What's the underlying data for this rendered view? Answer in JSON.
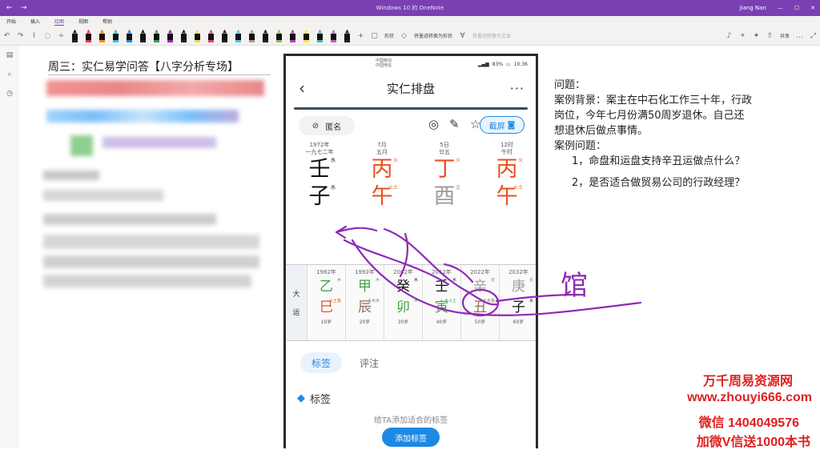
{
  "window": {
    "title": "Windows 10 的 OneNote",
    "user": "Jiang Nan"
  },
  "menu": [
    "开始",
    "插入",
    "绘图",
    "视图",
    "帮助"
  ],
  "menu_active": 2,
  "toolbar": {
    "shape_label": "形状",
    "ink_to_shape": "将墨迹转换为形状",
    "ink_to_text": "将墨迹转换为文本",
    "share": "共享"
  },
  "pens": [
    "#222222",
    "#e53935",
    "#fb8c00",
    "#26c6da",
    "#1e88e5",
    "#212121",
    "#43a047",
    "#9c27b0",
    "#212121",
    "#fdd835",
    "#ec407a",
    "#212121",
    "#4fc3f7",
    "#9e9e9e",
    "#212121",
    "#8bc34a",
    "#ab47bc",
    "#ffeb3b",
    "#4db6ac",
    "#ba68c8",
    "#212121"
  ],
  "doc": {
    "title": "周三：实仁易学问答【八字分析专场】"
  },
  "phone": {
    "status": {
      "carrier1": "中国移动",
      "carrier2": "中国电信",
      "battery": "83%",
      "time": "10:36"
    },
    "nav_title": "实仁排盘",
    "anon_label": "匿名",
    "screenshot_label": "截屏",
    "pillars": [
      {
        "l1": "1972年",
        "l2": "一九七二年",
        "gan": "壬",
        "zhi": "子",
        "gan_color": "#111111",
        "zhi_color": "#111111",
        "gsup": "水",
        "zsup": "水"
      },
      {
        "l1": "7月",
        "l2": "五月",
        "gan": "丙",
        "zhi": "午",
        "gan_color": "#e8501f",
        "zhi_color": "#e8501f",
        "gsup": "火",
        "zsup": "火土"
      },
      {
        "l1": "5日",
        "l2": "廿五",
        "gan": "丁",
        "zhi": "酉",
        "gan_color": "#e8501f",
        "zhi_color": "#9e9e9e",
        "gsup": "火",
        "zsup": "金"
      },
      {
        "l1": "12时",
        "l2": "午时",
        "gan": "丙",
        "zhi": "午",
        "gan_color": "#e8501f",
        "zhi_color": "#e8501f",
        "gsup": "火",
        "zsup": "火土"
      }
    ],
    "dayun_side": [
      "大",
      "运"
    ],
    "dayun": [
      {
        "yr": "1982年",
        "g": "乙",
        "z": "巳",
        "gc": "#43a047",
        "zc": "#e8501f",
        "age": "10岁",
        "gs": "木",
        "zs": "火土金"
      },
      {
        "yr": "1992年",
        "g": "甲",
        "z": "辰",
        "gc": "#43a047",
        "zc": "#8d6e63",
        "age": "20岁",
        "gs": "木",
        "zs": "土木水"
      },
      {
        "yr": "2002年",
        "g": "癸",
        "z": "卯",
        "gc": "#111111",
        "zc": "#43a047",
        "age": "30岁",
        "gs": "水",
        "zs": "木"
      },
      {
        "yr": "2012年",
        "g": "壬",
        "z": "寅",
        "gc": "#111111",
        "zc": "#43a047",
        "age": "40岁",
        "gs": "水",
        "zs": "木火土"
      },
      {
        "yr": "2022年",
        "g": "辛",
        "z": "丑",
        "gc": "#9e9e9e",
        "zc": "#8d6e63",
        "age": "50岁",
        "gs": "金",
        "zs": "土水金"
      },
      {
        "yr": "2032年",
        "g": "庚",
        "z": "子",
        "gc": "#9e9e9e",
        "zc": "#111111",
        "age": "60岁",
        "gs": "金",
        "zs": "水"
      }
    ],
    "tabs": [
      "标签",
      "评注"
    ],
    "tag_title": "标签",
    "tag_hint": "给TA添加适合的标签",
    "add_tag": "添加标签"
  },
  "qa": {
    "heading": "问题：",
    "background": "案例背景：案主在中石化工作三十年，行政岗位，今年七月份满50周岁退休。自己还想退休后做点事情。",
    "q_heading": "案例问题：",
    "q1": "1，命盘和运盘支持辛丑运做点什么？",
    "q2": "2，是否适合做贸易公司的行政经理？"
  },
  "handwriting": "馆",
  "watermark": {
    "line1": "万千周易资源网",
    "line2": "www.zhouyi666.com",
    "line3": "微信 1404049576",
    "line4": "加微V信送1000本书"
  },
  "colors": {
    "accent": "#7a3fb2",
    "blue": "#1e88e5",
    "ink": "#8e2bb5",
    "wm": "#e02020"
  }
}
